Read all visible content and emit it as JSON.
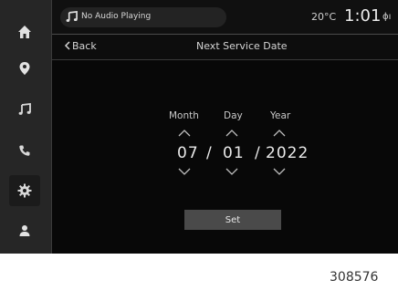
{
  "status_bar": {
    "audio_text": "No Audio Playing",
    "temperature": "20°C",
    "time": "1:01",
    "phone_status": "ɸı"
  },
  "header": {
    "back_label": "Back",
    "title": "Next Service Date"
  },
  "sidebar": {
    "items": [
      {
        "icon": "home-icon"
      },
      {
        "icon": "location-pin-icon"
      },
      {
        "icon": "music-note-icon"
      },
      {
        "icon": "phone-icon"
      },
      {
        "icon": "gear-icon",
        "active": true
      },
      {
        "icon": "user-icon"
      }
    ]
  },
  "date_picker": {
    "month_label": "Month",
    "day_label": "Day",
    "year_label": "Year",
    "month_value": "07",
    "day_value": "01",
    "year_value": "2022",
    "separator": "/"
  },
  "set_label": "Set",
  "figure_number": "308576",
  "colors": {
    "screen_bg": "#050505",
    "sidebar_bg": "#262626",
    "button_bg": "#4a4a4a",
    "text": "#e9e9e9"
  }
}
